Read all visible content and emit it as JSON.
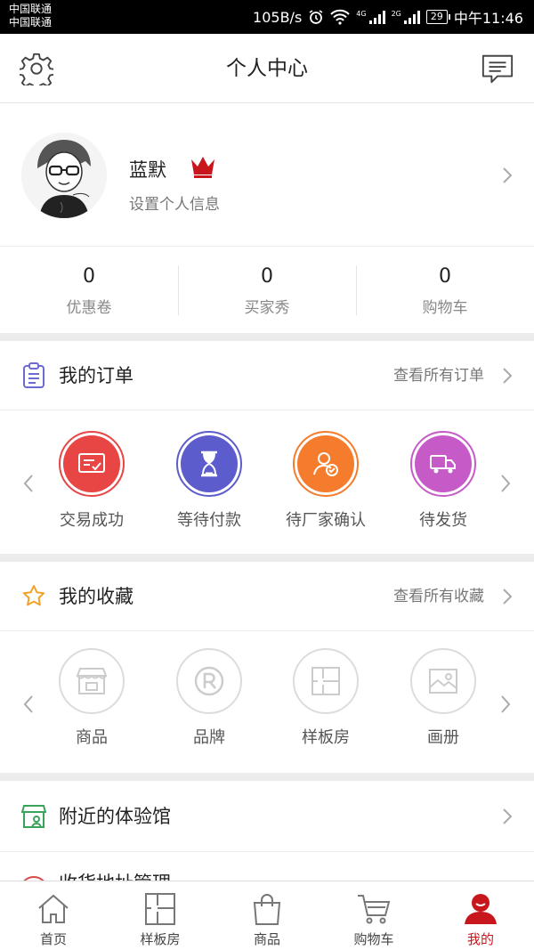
{
  "status_bar": {
    "carrier1": "中国联通",
    "carrier2": "中国联通",
    "speed": "105B/s",
    "net1": "4G",
    "net2": "2G",
    "battery": "29",
    "time": "中午11:46"
  },
  "header": {
    "title": "个人中心",
    "left_icon": "gear-icon",
    "right_icon": "message-icon"
  },
  "profile": {
    "name": "蓝默",
    "subtitle": "设置个人信息",
    "badge_icon": "crown-icon",
    "badge_color": "#c8161d"
  },
  "stats": [
    {
      "value": "0",
      "label": "优惠卷"
    },
    {
      "value": "0",
      "label": "买家秀"
    },
    {
      "value": "0",
      "label": "购物车"
    }
  ],
  "orders": {
    "title": "我的订单",
    "more": "查看所有订单",
    "items": [
      {
        "label": "交易成功",
        "icon": "deal-done-icon",
        "color": "#e84545"
      },
      {
        "label": "等待付款",
        "icon": "hourglass-icon",
        "color": "#5c5ccc"
      },
      {
        "label": "待厂家确认",
        "icon": "user-check-icon",
        "color": "#f47c2c"
      },
      {
        "label": "待发货",
        "icon": "truck-icon",
        "color": "#c65bc8"
      }
    ]
  },
  "favorites": {
    "title": "我的收藏",
    "more": "查看所有收藏",
    "items": [
      {
        "label": "商品",
        "icon": "shop-icon"
      },
      {
        "label": "品牌",
        "icon": "registered-icon"
      },
      {
        "label": "样板房",
        "icon": "floorplan-icon"
      },
      {
        "label": "画册",
        "icon": "album-icon"
      }
    ]
  },
  "nearby": {
    "title": "附近的体验馆"
  },
  "address": {
    "title": "收货地址管理"
  },
  "tabbar": [
    {
      "label": "首页",
      "icon": "home-icon",
      "active": false
    },
    {
      "label": "样板房",
      "icon": "floorplan-icon",
      "active": false
    },
    {
      "label": "商品",
      "icon": "bag-icon",
      "active": false
    },
    {
      "label": "购物车",
      "icon": "cart-icon",
      "active": false
    },
    {
      "label": "我的",
      "icon": "profile-icon",
      "active": true
    }
  ],
  "colors": {
    "accent": "#c8161d",
    "divider": "#ececec"
  }
}
